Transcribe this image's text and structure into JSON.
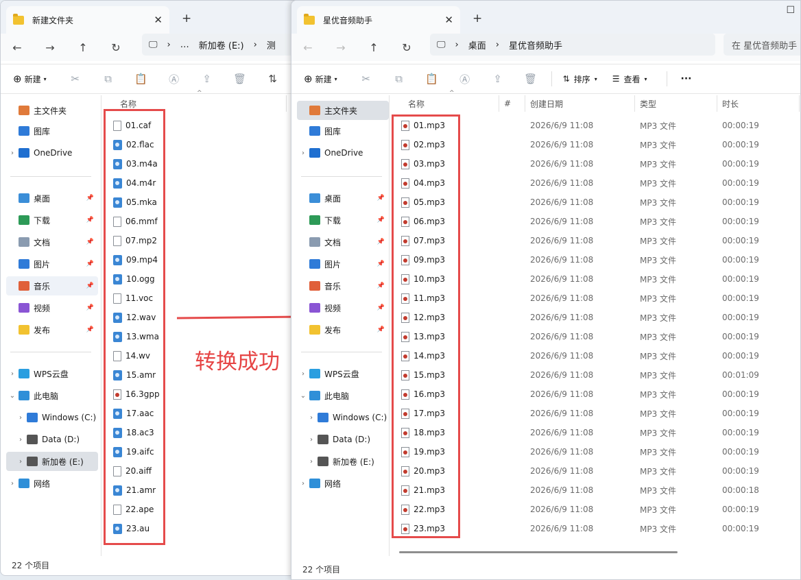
{
  "window1": {
    "tab_title": "新建文件夹",
    "address": {
      "items": [
        "…",
        "新加卷 (E:)",
        "测"
      ]
    },
    "toolbar": {
      "new_label": "新建"
    },
    "column_name": "名称",
    "sidebar": [
      {
        "label": "主文件夹",
        "icon": "home-icon",
        "color": "#e07a3a"
      },
      {
        "label": "图库",
        "icon": "gallery-icon",
        "color": "#2f7bd8"
      },
      {
        "label": "OneDrive",
        "icon": "cloud-icon",
        "color": "#1f6fd0"
      },
      {
        "label": "桌面",
        "icon": "desktop-icon",
        "color": "#3b8ed8"
      },
      {
        "label": "下载",
        "icon": "download-icon",
        "color": "#2d9a57"
      },
      {
        "label": "文档",
        "icon": "document-icon",
        "color": "#8a9bb0"
      },
      {
        "label": "图片",
        "icon": "pictures-icon",
        "color": "#2f7bd8"
      },
      {
        "label": "音乐",
        "icon": "music-icon",
        "color": "#e0603a"
      },
      {
        "label": "视频",
        "icon": "video-icon",
        "color": "#8a55d4"
      },
      {
        "label": "发布",
        "icon": "folder-icon",
        "color": "#f2c230"
      },
      {
        "label": "WPS云盘",
        "icon": "wps-cloud-icon",
        "color": "#2a9ee0"
      },
      {
        "label": "此电脑",
        "icon": "computer-icon",
        "color": "#2f8fd8"
      },
      {
        "label": "Windows (C:)",
        "icon": "windows-drive-icon",
        "color": "#2f7bd8"
      },
      {
        "label": "Data (D:)",
        "icon": "drive-icon",
        "color": "#555555"
      },
      {
        "label": "新加卷 (E:)",
        "icon": "drive-icon",
        "color": "#555555"
      },
      {
        "label": "网络",
        "icon": "network-icon",
        "color": "#2f8fd8"
      }
    ],
    "files": [
      {
        "name": "01.caf",
        "icon": "doc"
      },
      {
        "name": "02.flac",
        "icon": "media"
      },
      {
        "name": "03.m4a",
        "icon": "media"
      },
      {
        "name": "04.m4r",
        "icon": "media"
      },
      {
        "name": "05.mka",
        "icon": "media"
      },
      {
        "name": "06.mmf",
        "icon": "doc"
      },
      {
        "name": "07.mp2",
        "icon": "doc"
      },
      {
        "name": "09.mp4",
        "icon": "media"
      },
      {
        "name": "10.ogg",
        "icon": "media"
      },
      {
        "name": "11.voc",
        "icon": "doc"
      },
      {
        "name": "12.wav",
        "icon": "media"
      },
      {
        "name": "13.wma",
        "icon": "media"
      },
      {
        "name": "14.wv",
        "icon": "doc"
      },
      {
        "name": "15.amr",
        "icon": "media"
      },
      {
        "name": "16.3gpp",
        "icon": "mp3"
      },
      {
        "name": "17.aac",
        "icon": "media"
      },
      {
        "name": "18.ac3",
        "icon": "media"
      },
      {
        "name": "19.aifc",
        "icon": "media"
      },
      {
        "name": "20.aiff",
        "icon": "doc"
      },
      {
        "name": "21.amr",
        "icon": "media"
      },
      {
        "name": "22.ape",
        "icon": "doc"
      },
      {
        "name": "23.au",
        "icon": "media"
      }
    ],
    "status": "22 个项目"
  },
  "window2": {
    "tab_title": "星优音频助手",
    "address": {
      "items": [
        "桌面",
        "星优音频助手"
      ]
    },
    "search_placeholder": "在 星优音频助手",
    "toolbar": {
      "new_label": "新建",
      "sort_label": "排序",
      "view_label": "查看",
      "more_label": "···"
    },
    "columns": {
      "name": "名称",
      "num": "#",
      "created": "创建日期",
      "type": "类型",
      "duration": "时长"
    },
    "files": [
      {
        "name": "01.mp3",
        "created": "2026/6/9 11:08",
        "type": "MP3 文件",
        "duration": "00:00:19"
      },
      {
        "name": "02.mp3",
        "created": "2026/6/9 11:08",
        "type": "MP3 文件",
        "duration": "00:00:19"
      },
      {
        "name": "03.mp3",
        "created": "2026/6/9 11:08",
        "type": "MP3 文件",
        "duration": "00:00:19"
      },
      {
        "name": "04.mp3",
        "created": "2026/6/9 11:08",
        "type": "MP3 文件",
        "duration": "00:00:19"
      },
      {
        "name": "05.mp3",
        "created": "2026/6/9 11:08",
        "type": "MP3 文件",
        "duration": "00:00:19"
      },
      {
        "name": "06.mp3",
        "created": "2026/6/9 11:08",
        "type": "MP3 文件",
        "duration": "00:00:19"
      },
      {
        "name": "07.mp3",
        "created": "2026/6/9 11:08",
        "type": "MP3 文件",
        "duration": "00:00:19"
      },
      {
        "name": "09.mp3",
        "created": "2026/6/9 11:08",
        "type": "MP3 文件",
        "duration": "00:00:19"
      },
      {
        "name": "10.mp3",
        "created": "2026/6/9 11:08",
        "type": "MP3 文件",
        "duration": "00:00:19"
      },
      {
        "name": "11.mp3",
        "created": "2026/6/9 11:08",
        "type": "MP3 文件",
        "duration": "00:00:19"
      },
      {
        "name": "12.mp3",
        "created": "2026/6/9 11:08",
        "type": "MP3 文件",
        "duration": "00:00:19"
      },
      {
        "name": "13.mp3",
        "created": "2026/6/9 11:08",
        "type": "MP3 文件",
        "duration": "00:00:19"
      },
      {
        "name": "14.mp3",
        "created": "2026/6/9 11:08",
        "type": "MP3 文件",
        "duration": "00:00:19"
      },
      {
        "name": "15.mp3",
        "created": "2026/6/9 11:08",
        "type": "MP3 文件",
        "duration": "00:01:09"
      },
      {
        "name": "16.mp3",
        "created": "2026/6/9 11:08",
        "type": "MP3 文件",
        "duration": "00:00:19"
      },
      {
        "name": "17.mp3",
        "created": "2026/6/9 11:08",
        "type": "MP3 文件",
        "duration": "00:00:19"
      },
      {
        "name": "18.mp3",
        "created": "2026/6/9 11:08",
        "type": "MP3 文件",
        "duration": "00:00:19"
      },
      {
        "name": "19.mp3",
        "created": "2026/6/9 11:08",
        "type": "MP3 文件",
        "duration": "00:00:19"
      },
      {
        "name": "20.mp3",
        "created": "2026/6/9 11:08",
        "type": "MP3 文件",
        "duration": "00:00:19"
      },
      {
        "name": "21.mp3",
        "created": "2026/6/9 11:08",
        "type": "MP3 文件",
        "duration": "00:00:18"
      },
      {
        "name": "22.mp3",
        "created": "2026/6/9 11:08",
        "type": "MP3 文件",
        "duration": "00:00:19"
      },
      {
        "name": "23.mp3",
        "created": "2026/6/9 11:08",
        "type": "MP3 文件",
        "duration": "00:00:19"
      }
    ],
    "status": "22 个项目"
  },
  "annotation": {
    "text": "转换成功",
    "color": "#e64545"
  }
}
